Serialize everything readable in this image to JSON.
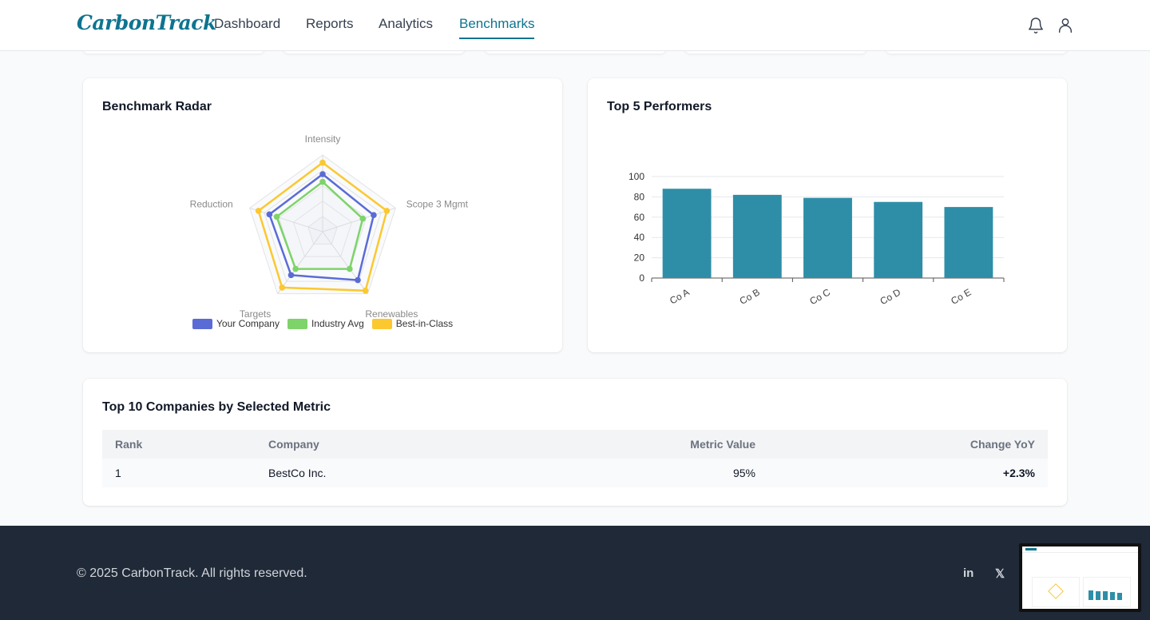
{
  "brand": {
    "logo": "CarbonTrack"
  },
  "nav": {
    "items": [
      {
        "label": "Dashboard",
        "active": false
      },
      {
        "label": "Reports",
        "active": false
      },
      {
        "label": "Analytics",
        "active": false
      },
      {
        "label": "Benchmarks",
        "active": true
      }
    ],
    "icons": [
      "bell-icon",
      "user-icon"
    ]
  },
  "colors": {
    "accent": "#0e7490",
    "bar": "#2e8ea8",
    "your_company": "#5b6bd6",
    "industry_avg": "#7ed36a",
    "best_in_class": "#fbc830",
    "positive": "#16a34a",
    "footer_bg": "#1f2937"
  },
  "radar": {
    "title": "Benchmark Radar",
    "chart_data": {
      "type": "radar",
      "axes": [
        "Intensity",
        "Scope 3 Mgmt",
        "Renewables",
        "Targets",
        "Reduction"
      ],
      "rmax": 100,
      "series": [
        {
          "name": "Your Company",
          "values": [
            75,
            70,
            78,
            70,
            73
          ]
        },
        {
          "name": "Industry Avg",
          "values": [
            65,
            55,
            60,
            60,
            63
          ]
        },
        {
          "name": "Best-in-Class",
          "values": [
            90,
            88,
            95,
            90,
            88
          ]
        }
      ]
    }
  },
  "bars": {
    "title": "Top 5 Performers",
    "chart_data": {
      "type": "bar",
      "categories": [
        "Co A",
        "Co B",
        "Co C",
        "Co D",
        "Co E"
      ],
      "values": [
        88,
        82,
        79,
        75,
        70
      ],
      "ylim": [
        0,
        100
      ],
      "yticks": [
        0,
        20,
        40,
        60,
        80,
        100
      ],
      "grid": true
    }
  },
  "table": {
    "title": "Top 10 Companies by Selected Metric",
    "headers": {
      "rank": "Rank",
      "company": "Company",
      "metric": "Metric Value",
      "change": "Change YoY"
    },
    "rows": [
      {
        "rank": "1",
        "company": "BestCo Inc.",
        "metric": "95%",
        "change": "+2.3%"
      }
    ]
  },
  "footer": {
    "copyright": "© 2025 CarbonTrack. All rights reserved.",
    "social": [
      {
        "icon": "linkedin-icon",
        "label": "in"
      },
      {
        "icon": "x-icon",
        "label": "𝕏"
      }
    ]
  }
}
